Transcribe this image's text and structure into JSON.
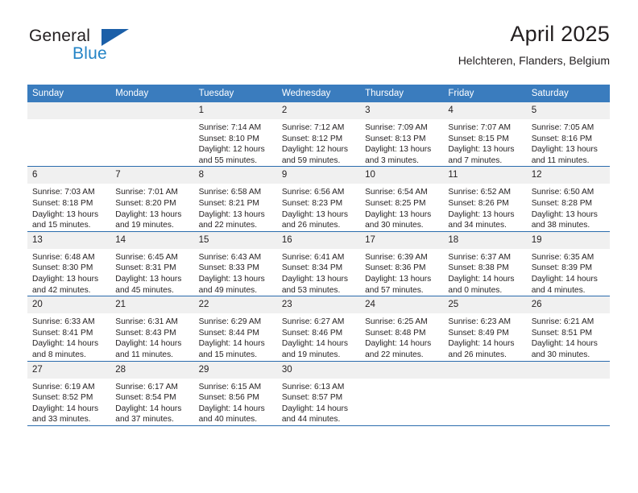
{
  "brand": {
    "name_top": "General",
    "name_bottom": "Blue",
    "flag_icon": "triangle-flag-icon",
    "accent_color": "#2484c6",
    "flag_color": "#1b5fa8"
  },
  "header": {
    "title": "April 2025",
    "location": "Helchteren, Flanders, Belgium"
  },
  "calendar": {
    "header_bg": "#3a7cbe",
    "header_text_color": "#ffffff",
    "daynum_bg": "#f0f0f0",
    "row_divider_color": "#2b6cad",
    "weekdays": [
      "Sunday",
      "Monday",
      "Tuesday",
      "Wednesday",
      "Thursday",
      "Friday",
      "Saturday"
    ],
    "weeks": [
      [
        {
          "day": "",
          "blank": true
        },
        {
          "day": "",
          "blank": true
        },
        {
          "day": "1",
          "sunrise": "Sunrise: 7:14 AM",
          "sunset": "Sunset: 8:10 PM",
          "daylight_1": "Daylight: 12 hours",
          "daylight_2": "and 55 minutes."
        },
        {
          "day": "2",
          "sunrise": "Sunrise: 7:12 AM",
          "sunset": "Sunset: 8:12 PM",
          "daylight_1": "Daylight: 12 hours",
          "daylight_2": "and 59 minutes."
        },
        {
          "day": "3",
          "sunrise": "Sunrise: 7:09 AM",
          "sunset": "Sunset: 8:13 PM",
          "daylight_1": "Daylight: 13 hours",
          "daylight_2": "and 3 minutes."
        },
        {
          "day": "4",
          "sunrise": "Sunrise: 7:07 AM",
          "sunset": "Sunset: 8:15 PM",
          "daylight_1": "Daylight: 13 hours",
          "daylight_2": "and 7 minutes."
        },
        {
          "day": "5",
          "sunrise": "Sunrise: 7:05 AM",
          "sunset": "Sunset: 8:16 PM",
          "daylight_1": "Daylight: 13 hours",
          "daylight_2": "and 11 minutes."
        }
      ],
      [
        {
          "day": "6",
          "sunrise": "Sunrise: 7:03 AM",
          "sunset": "Sunset: 8:18 PM",
          "daylight_1": "Daylight: 13 hours",
          "daylight_2": "and 15 minutes."
        },
        {
          "day": "7",
          "sunrise": "Sunrise: 7:01 AM",
          "sunset": "Sunset: 8:20 PM",
          "daylight_1": "Daylight: 13 hours",
          "daylight_2": "and 19 minutes."
        },
        {
          "day": "8",
          "sunrise": "Sunrise: 6:58 AM",
          "sunset": "Sunset: 8:21 PM",
          "daylight_1": "Daylight: 13 hours",
          "daylight_2": "and 22 minutes."
        },
        {
          "day": "9",
          "sunrise": "Sunrise: 6:56 AM",
          "sunset": "Sunset: 8:23 PM",
          "daylight_1": "Daylight: 13 hours",
          "daylight_2": "and 26 minutes."
        },
        {
          "day": "10",
          "sunrise": "Sunrise: 6:54 AM",
          "sunset": "Sunset: 8:25 PM",
          "daylight_1": "Daylight: 13 hours",
          "daylight_2": "and 30 minutes."
        },
        {
          "day": "11",
          "sunrise": "Sunrise: 6:52 AM",
          "sunset": "Sunset: 8:26 PM",
          "daylight_1": "Daylight: 13 hours",
          "daylight_2": "and 34 minutes."
        },
        {
          "day": "12",
          "sunrise": "Sunrise: 6:50 AM",
          "sunset": "Sunset: 8:28 PM",
          "daylight_1": "Daylight: 13 hours",
          "daylight_2": "and 38 minutes."
        }
      ],
      [
        {
          "day": "13",
          "sunrise": "Sunrise: 6:48 AM",
          "sunset": "Sunset: 8:30 PM",
          "daylight_1": "Daylight: 13 hours",
          "daylight_2": "and 42 minutes."
        },
        {
          "day": "14",
          "sunrise": "Sunrise: 6:45 AM",
          "sunset": "Sunset: 8:31 PM",
          "daylight_1": "Daylight: 13 hours",
          "daylight_2": "and 45 minutes."
        },
        {
          "day": "15",
          "sunrise": "Sunrise: 6:43 AM",
          "sunset": "Sunset: 8:33 PM",
          "daylight_1": "Daylight: 13 hours",
          "daylight_2": "and 49 minutes."
        },
        {
          "day": "16",
          "sunrise": "Sunrise: 6:41 AM",
          "sunset": "Sunset: 8:34 PM",
          "daylight_1": "Daylight: 13 hours",
          "daylight_2": "and 53 minutes."
        },
        {
          "day": "17",
          "sunrise": "Sunrise: 6:39 AM",
          "sunset": "Sunset: 8:36 PM",
          "daylight_1": "Daylight: 13 hours",
          "daylight_2": "and 57 minutes."
        },
        {
          "day": "18",
          "sunrise": "Sunrise: 6:37 AM",
          "sunset": "Sunset: 8:38 PM",
          "daylight_1": "Daylight: 14 hours",
          "daylight_2": "and 0 minutes."
        },
        {
          "day": "19",
          "sunrise": "Sunrise: 6:35 AM",
          "sunset": "Sunset: 8:39 PM",
          "daylight_1": "Daylight: 14 hours",
          "daylight_2": "and 4 minutes."
        }
      ],
      [
        {
          "day": "20",
          "sunrise": "Sunrise: 6:33 AM",
          "sunset": "Sunset: 8:41 PM",
          "daylight_1": "Daylight: 14 hours",
          "daylight_2": "and 8 minutes."
        },
        {
          "day": "21",
          "sunrise": "Sunrise: 6:31 AM",
          "sunset": "Sunset: 8:43 PM",
          "daylight_1": "Daylight: 14 hours",
          "daylight_2": "and 11 minutes."
        },
        {
          "day": "22",
          "sunrise": "Sunrise: 6:29 AM",
          "sunset": "Sunset: 8:44 PM",
          "daylight_1": "Daylight: 14 hours",
          "daylight_2": "and 15 minutes."
        },
        {
          "day": "23",
          "sunrise": "Sunrise: 6:27 AM",
          "sunset": "Sunset: 8:46 PM",
          "daylight_1": "Daylight: 14 hours",
          "daylight_2": "and 19 minutes."
        },
        {
          "day": "24",
          "sunrise": "Sunrise: 6:25 AM",
          "sunset": "Sunset: 8:48 PM",
          "daylight_1": "Daylight: 14 hours",
          "daylight_2": "and 22 minutes."
        },
        {
          "day": "25",
          "sunrise": "Sunrise: 6:23 AM",
          "sunset": "Sunset: 8:49 PM",
          "daylight_1": "Daylight: 14 hours",
          "daylight_2": "and 26 minutes."
        },
        {
          "day": "26",
          "sunrise": "Sunrise: 6:21 AM",
          "sunset": "Sunset: 8:51 PM",
          "daylight_1": "Daylight: 14 hours",
          "daylight_2": "and 30 minutes."
        }
      ],
      [
        {
          "day": "27",
          "sunrise": "Sunrise: 6:19 AM",
          "sunset": "Sunset: 8:52 PM",
          "daylight_1": "Daylight: 14 hours",
          "daylight_2": "and 33 minutes."
        },
        {
          "day": "28",
          "sunrise": "Sunrise: 6:17 AM",
          "sunset": "Sunset: 8:54 PM",
          "daylight_1": "Daylight: 14 hours",
          "daylight_2": "and 37 minutes."
        },
        {
          "day": "29",
          "sunrise": "Sunrise: 6:15 AM",
          "sunset": "Sunset: 8:56 PM",
          "daylight_1": "Daylight: 14 hours",
          "daylight_2": "and 40 minutes."
        },
        {
          "day": "30",
          "sunrise": "Sunrise: 6:13 AM",
          "sunset": "Sunset: 8:57 PM",
          "daylight_1": "Daylight: 14 hours",
          "daylight_2": "and 44 minutes."
        },
        {
          "day": "",
          "blank": true
        },
        {
          "day": "",
          "blank": true
        },
        {
          "day": "",
          "blank": true
        }
      ]
    ]
  }
}
